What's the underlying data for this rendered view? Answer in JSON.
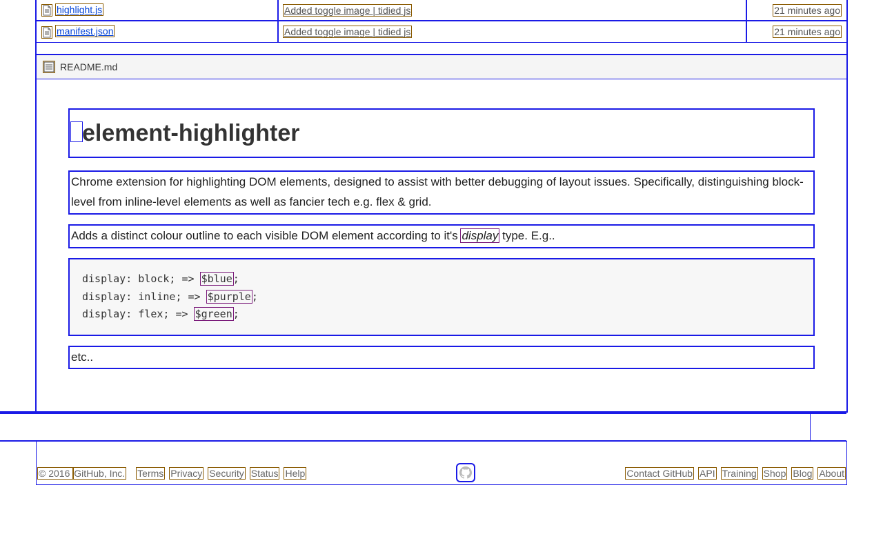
{
  "file_rows": [
    {
      "name": "highlight.js",
      "commit_msg": "Added toggle image | tidied js",
      "time": "21 minutes ago"
    },
    {
      "name": "manifest.json",
      "commit_msg": "Added toggle image | tidied js",
      "time": "21 minutes ago"
    }
  ],
  "readme": {
    "filename": "README.md",
    "heading": "element-highlighter",
    "para1": "Chrome extension for highlighting DOM elements, designed to assist with better debugging of layout issues. Specifically, distinguishing block-level from inline-level elements as well as fancier tech e.g. flex & grid.",
    "para2_pre": "Adds a distinct colour outline to each visible DOM element according to it's ",
    "para2_em": "display",
    "para2_post": " type. E.g..",
    "code_lines": [
      {
        "pre": "display: block; => ",
        "var": "$blue",
        "post": ";"
      },
      {
        "pre": "display: inline; => ",
        "var": "$purple",
        "post": ";"
      },
      {
        "pre": "display: flex; => ",
        "var": "$green",
        "post": ";"
      }
    ],
    "para3": "etc.."
  },
  "footer": {
    "copyright": "© 2016 ",
    "company": "GitHub, Inc.",
    "left_links": [
      "Terms",
      "Privacy",
      "Security",
      "Status",
      "Help"
    ],
    "right_links": [
      "Contact GitHub",
      "API",
      "Training",
      "Shop",
      "Blog",
      "About"
    ]
  }
}
